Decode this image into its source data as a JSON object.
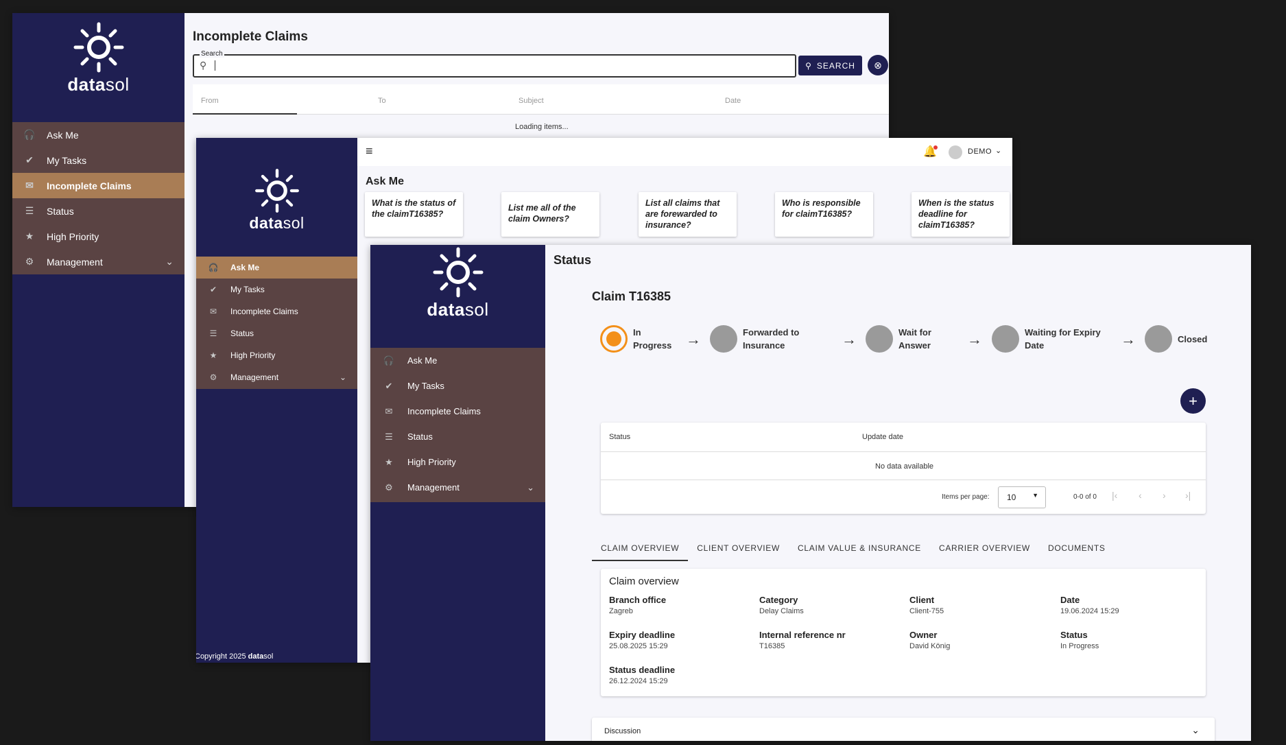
{
  "brand": {
    "name_bold": "data",
    "name_light": "sol"
  },
  "menu": [
    {
      "label": "Ask Me",
      "icon": "headset-icon"
    },
    {
      "label": "My Tasks",
      "icon": "check-circle-icon"
    },
    {
      "label": "Incomplete Claims",
      "icon": "envelope-open-icon"
    },
    {
      "label": "Status",
      "icon": "sliders-icon"
    },
    {
      "label": "High Priority",
      "icon": "star-icon"
    },
    {
      "label": "Management",
      "icon": "gear-icon"
    }
  ],
  "win1": {
    "title": "Incomplete Claims",
    "search_label": "Search",
    "search_button": "SEARCH",
    "columns": [
      "From",
      "To",
      "Subject",
      "Date"
    ],
    "loading": "Loading items..."
  },
  "win2": {
    "user": "DEMO",
    "title": "Ask Me",
    "questions": [
      "What is the status of the claimT16385?",
      "List me all of the claim Owners?",
      "List all claims that are forewarded to insurance?",
      "Who is responsible for claimT16385?",
      "When is the status deadline for claimT16385?"
    ],
    "copyright_prefix": "Copyright 2025 ",
    "copyright_bold": "data",
    "copyright_rest": "sol"
  },
  "win3": {
    "title": "Status",
    "claim_title": "Claim T16385",
    "steps": [
      {
        "label": "In Progress",
        "active": true
      },
      {
        "label": "Forwarded to Insurance",
        "active": false
      },
      {
        "label": "Wait for Answer",
        "active": false
      },
      {
        "label": "Waiting for Expiry Date",
        "active": false
      },
      {
        "label": "Closed",
        "active": false
      }
    ],
    "table": {
      "col_status": "Status",
      "col_update": "Update date",
      "empty": "No data available",
      "items_per_page_label": "Items per page:",
      "items_per_page": "10",
      "range": "0-0 of 0"
    },
    "tabs": [
      "CLAIM OVERVIEW",
      "CLIENT OVERVIEW",
      "CLAIM VALUE & INSURANCE",
      "CARRIER OVERVIEW",
      "DOCUMENTS"
    ],
    "overview_title": "Claim overview",
    "fields": [
      {
        "k": "Branch office",
        "v": "Zagreb"
      },
      {
        "k": "Category",
        "v": "Delay Claims"
      },
      {
        "k": "Client",
        "v": "Client-755"
      },
      {
        "k": "Date",
        "v": "19.06.2024 15:29"
      },
      {
        "k": "Expiry deadline",
        "v": "25.08.2025 15:29"
      },
      {
        "k": "Internal reference nr",
        "v": "T16385"
      },
      {
        "k": "Owner",
        "v": "David König"
      },
      {
        "k": "Status",
        "v": "In Progress"
      },
      {
        "k": "Status deadline",
        "v": "26.12.2024 15:29"
      }
    ],
    "discussion": "Discussion"
  },
  "colors": {
    "sidebar": "#1f1f52",
    "menu": "#5a4343",
    "active": "#a97d55",
    "accent_orange": "#f39019"
  }
}
